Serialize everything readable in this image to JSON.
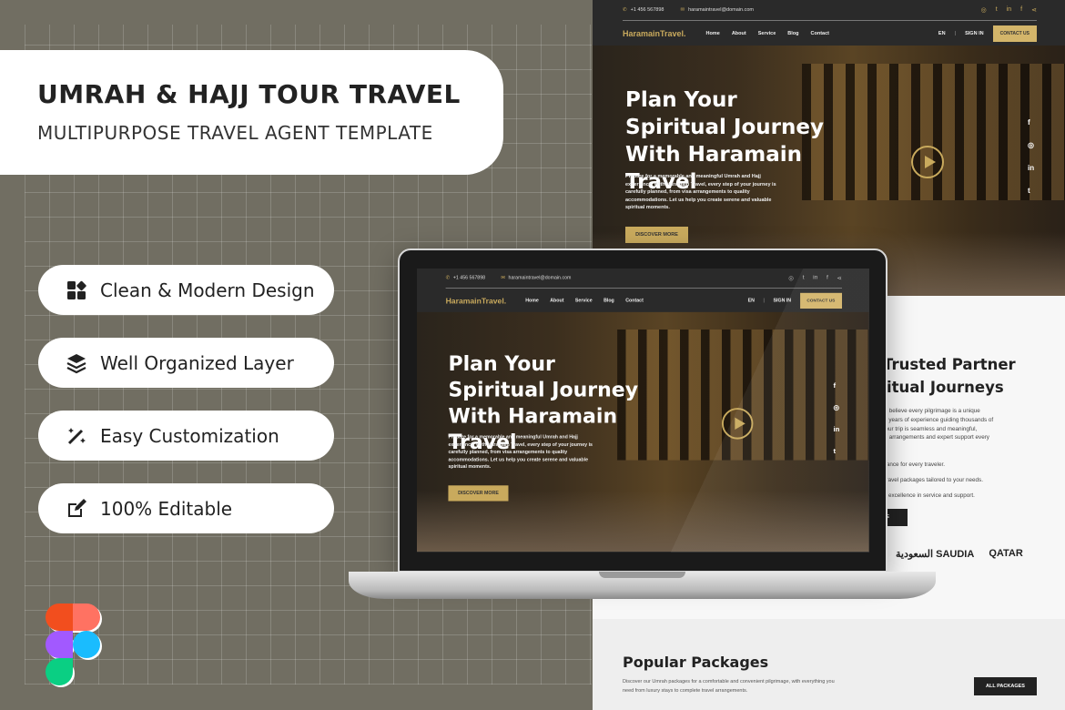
{
  "promo": {
    "title": "UMRAH & HAJJ TOUR TRAVEL",
    "subtitle": "MULTIPURPOSE TRAVEL AGENT TEMPLATE",
    "features": [
      {
        "label": "Clean & Modern Design",
        "icon": "grid-icon"
      },
      {
        "label": "Well Organized Layer",
        "icon": "layers-icon"
      },
      {
        "label": "Easy Customization",
        "icon": "magic-wand-icon"
      },
      {
        "label": "100% Editable",
        "icon": "edit-icon"
      }
    ]
  },
  "site": {
    "phone": "+1 456 567898",
    "email": "haramaintravel@domain.com",
    "logo": "HaramainTravel.",
    "nav": [
      "Home",
      "About",
      "Service",
      "Blog",
      "Contact"
    ],
    "lang": "EN",
    "signin": "SIGN IN",
    "contact": "CONTACT US",
    "social_top": [
      "instagram",
      "twitter",
      "linkedin",
      "facebook",
      "share"
    ],
    "hero": {
      "title": "Plan Your Spiritual Journey With Haramain Travel",
      "text": "Prepare for a memorable and meaningful Umrah and Hajj experience. With Haramain Travel, every step of your journey is carefully planned, from visa arrangements to quality accommodations. Let us help you create serene and valuable spiritual moments.",
      "button": "DISCOVER MORE"
    }
  },
  "about": {
    "title1": "Trusted Partner",
    "title2": "itual Journeys",
    "lines": [
      "l, we believe every pilgrimage is a unique",
      "With years of experience guiding thousands of",
      "re your trip is seamless and meaningful,",
      "lized arrangements and expert support every"
    ],
    "points": [
      "guidance for every traveler.",
      "ive travel packages tailored to your needs.",
      "nt to excellence in service and support."
    ],
    "button": "RE",
    "partners": [
      "السعودية SAUDIA",
      "QATAR"
    ]
  },
  "packages": {
    "title": "Popular Packages",
    "text": "Discover our Umrah packages for a comfortable and convenient pilgrimage, with everything you need from luxury stays to complete travel arrangements.",
    "button": "ALL PACKAGES"
  },
  "colors": {
    "background": "#716e62",
    "gold": "#c9aa5d",
    "dark": "#2a2a2a"
  }
}
